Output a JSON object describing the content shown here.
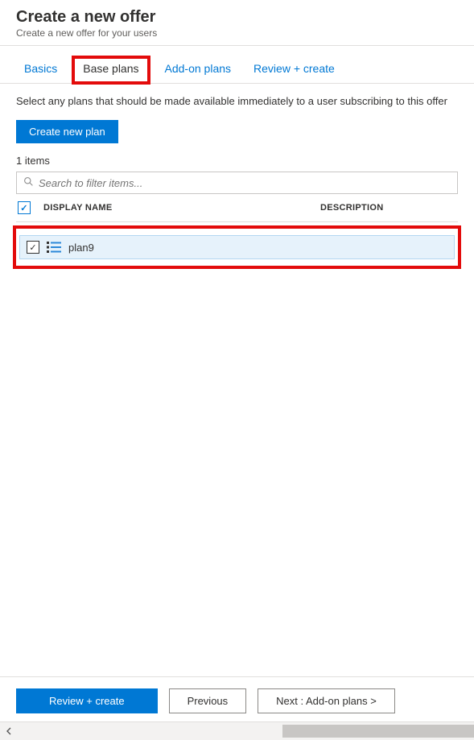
{
  "header": {
    "title": "Create a new offer",
    "subtitle": "Create a new offer for your users"
  },
  "tabs": {
    "basics": "Basics",
    "base_plans": "Base plans",
    "addon_plans": "Add-on plans",
    "review_create": "Review + create"
  },
  "content": {
    "intro": "Select any plans that should be made available immediately to a user subscribing to this offer",
    "create_button": "Create new plan",
    "item_count": "1 items",
    "search_placeholder": "Search to filter items...",
    "columns": {
      "display_name": "DISPLAY NAME",
      "description": "DESCRIPTION"
    },
    "rows": [
      {
        "name": "plan9",
        "checked": true
      }
    ]
  },
  "footer": {
    "review_create": "Review + create",
    "previous": "Previous",
    "next": "Next : Add-on plans >"
  }
}
